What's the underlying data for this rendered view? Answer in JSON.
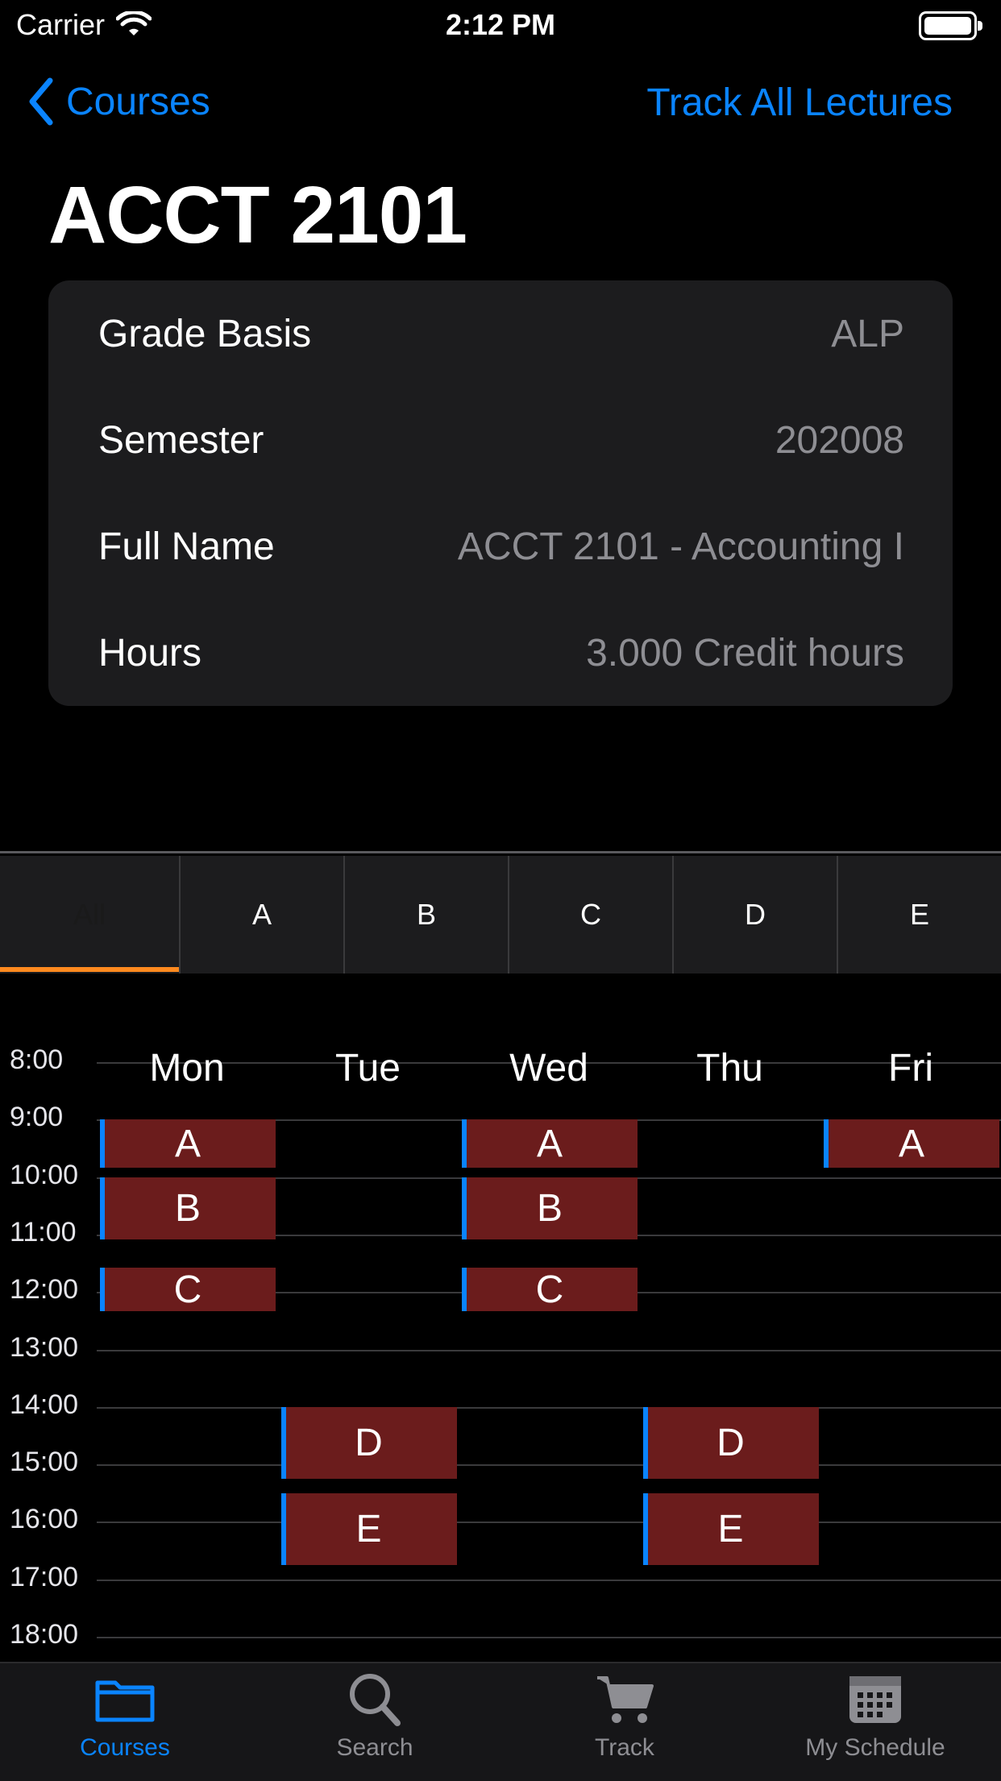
{
  "status_bar": {
    "carrier": "Carrier",
    "time": "2:12 PM"
  },
  "nav": {
    "back_label": "Courses",
    "right_action": "Track All Lectures"
  },
  "title": "ACCT 2101",
  "info_rows": [
    {
      "label": "Grade Basis",
      "value": "ALP"
    },
    {
      "label": "Semester",
      "value": "202008"
    },
    {
      "label": "Full Name",
      "value": "ACCT 2101 - Accounting I"
    },
    {
      "label": "Hours",
      "value": "3.000 Credit hours"
    }
  ],
  "section_tabs": [
    "All",
    "A",
    "B",
    "C",
    "D",
    "E"
  ],
  "active_section_tab": "All",
  "schedule": {
    "times": [
      "8:00",
      "9:00",
      "10:00",
      "11:00",
      "12:00",
      "13:00",
      "14:00",
      "15:00",
      "16:00",
      "17:00",
      "18:00"
    ],
    "days": [
      "Mon",
      "Tue",
      "Wed",
      "Thu",
      "Fri"
    ],
    "blocks": [
      {
        "label": "A",
        "day": "Mon",
        "start": "9:00",
        "end": "9:50"
      },
      {
        "label": "A",
        "day": "Wed",
        "start": "9:00",
        "end": "9:50"
      },
      {
        "label": "A",
        "day": "Fri",
        "start": "9:00",
        "end": "9:50"
      },
      {
        "label": "B",
        "day": "Mon",
        "start": "10:00",
        "end": "11:05"
      },
      {
        "label": "B",
        "day": "Wed",
        "start": "10:00",
        "end": "11:05"
      },
      {
        "label": "C",
        "day": "Mon",
        "start": "11:35",
        "end": "12:20"
      },
      {
        "label": "C",
        "day": "Wed",
        "start": "11:35",
        "end": "12:20"
      },
      {
        "label": "D",
        "day": "Tue",
        "start": "14:00",
        "end": "15:15"
      },
      {
        "label": "D",
        "day": "Thu",
        "start": "14:00",
        "end": "15:15"
      },
      {
        "label": "E",
        "day": "Tue",
        "start": "15:30",
        "end": "16:45"
      },
      {
        "label": "E",
        "day": "Thu",
        "start": "15:30",
        "end": "16:45"
      }
    ]
  },
  "bottom_tabs": [
    {
      "label": "Courses",
      "icon": "folder-icon"
    },
    {
      "label": "Search",
      "icon": "magnifier-icon"
    },
    {
      "label": "Track",
      "icon": "cart-icon"
    },
    {
      "label": "My Schedule",
      "icon": "calendar-icon"
    }
  ],
  "active_bottom_tab": "Courses",
  "colors": {
    "accent": "#0a84ff",
    "block_fill": "#6b1c1c",
    "tab_indicator": "#ff8a1f"
  }
}
